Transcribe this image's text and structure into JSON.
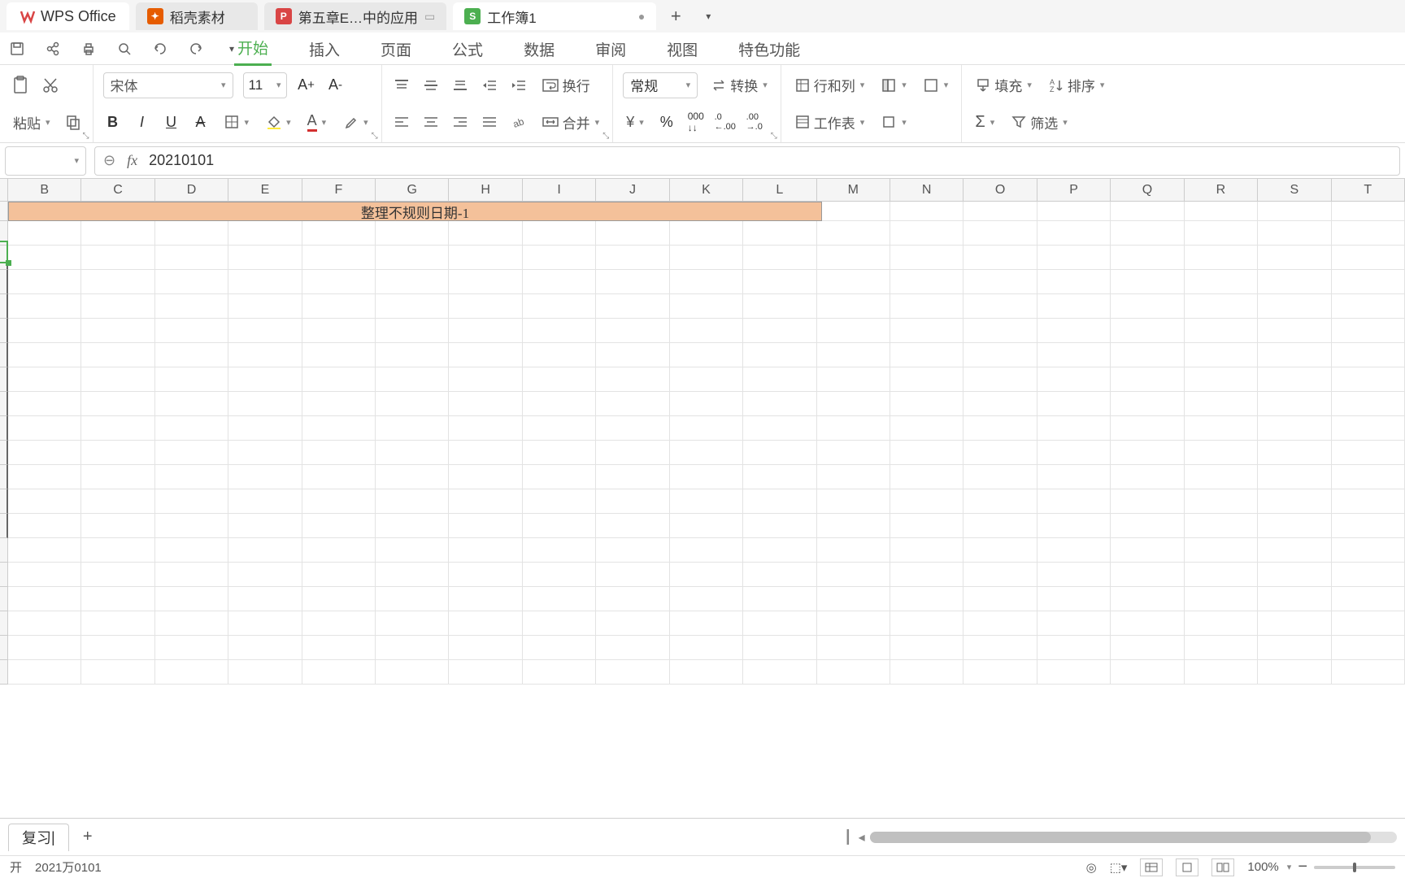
{
  "tabs": {
    "home": "WPS Office",
    "doc1": "稻壳素材",
    "doc2": "第五章E…中的应用",
    "doc3": "工作簿1"
  },
  "menu": {
    "start": "开始",
    "insert": "插入",
    "page": "页面",
    "formula": "公式",
    "data": "数据",
    "review": "审阅",
    "view": "视图",
    "special": "特色功能"
  },
  "ribbon": {
    "paste": "粘贴",
    "font_name": "宋体",
    "font_size": "11",
    "wrap": "换行",
    "merge": "合并",
    "number_format": "常规",
    "convert": "转换",
    "rowcol": "行和列",
    "worksheet": "工作表",
    "fill": "填充",
    "sort": "排序",
    "filter": "筛选"
  },
  "formula_bar": {
    "namebox": "",
    "fx": "fx",
    "value": "20210101"
  },
  "columns": [
    "B",
    "C",
    "D",
    "E",
    "F",
    "G",
    "H",
    "I",
    "J",
    "K",
    "L",
    "M",
    "N",
    "O",
    "P",
    "Q",
    "R",
    "S",
    "T"
  ],
  "merged_title": "整理不规则日期-1",
  "sheet": {
    "name": "复习",
    "editing_cursor": "|"
  },
  "status": {
    "left": "2021万0101",
    "zoom": "100%"
  }
}
